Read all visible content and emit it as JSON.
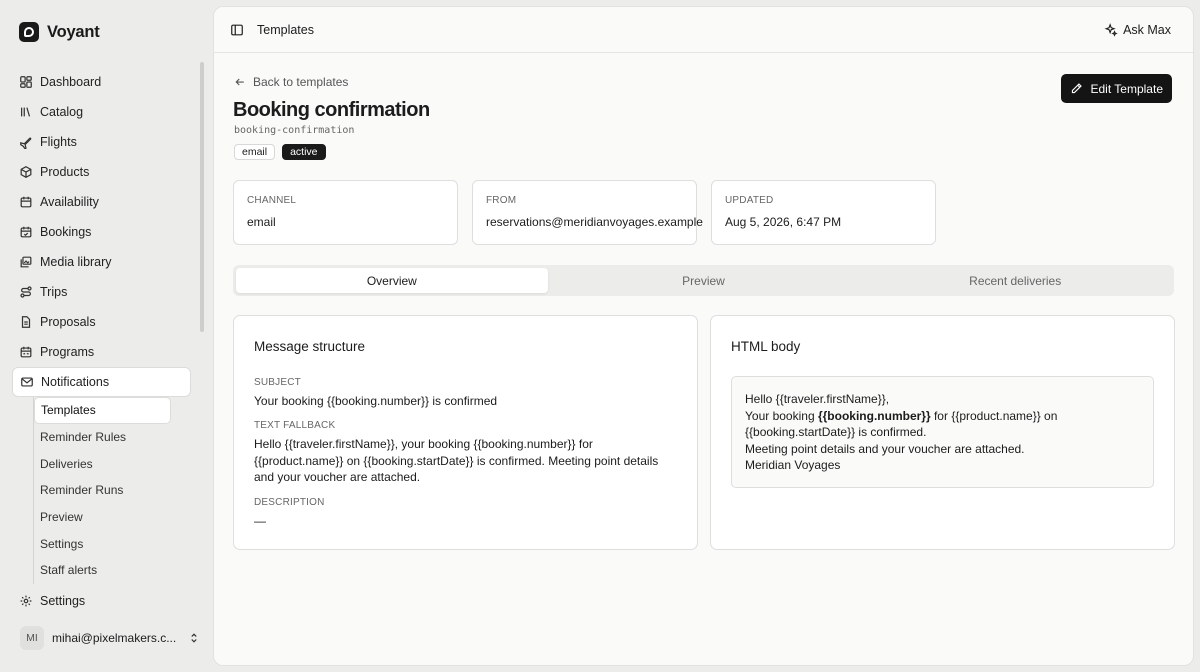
{
  "brand": {
    "name": "Voyant"
  },
  "nav": {
    "items": [
      {
        "label": "Dashboard"
      },
      {
        "label": "Catalog"
      },
      {
        "label": "Flights"
      },
      {
        "label": "Products"
      },
      {
        "label": "Availability"
      },
      {
        "label": "Bookings"
      },
      {
        "label": "Media library"
      },
      {
        "label": "Trips"
      },
      {
        "label": "Proposals"
      },
      {
        "label": "Programs"
      },
      {
        "label": "Notifications"
      }
    ],
    "sub_items": [
      {
        "label": "Templates"
      },
      {
        "label": "Reminder Rules"
      },
      {
        "label": "Deliveries"
      },
      {
        "label": "Reminder Runs"
      },
      {
        "label": "Preview"
      },
      {
        "label": "Settings"
      },
      {
        "label": "Staff alerts"
      }
    ],
    "settings": "Settings"
  },
  "user": {
    "initials": "MI",
    "email": "mihai@pixelmakers.c..."
  },
  "topbar": {
    "title": "Templates",
    "ask": "Ask Max"
  },
  "page": {
    "back": "Back to templates",
    "title": "Booking confirmation",
    "slug": "booking-confirmation",
    "tags": [
      "email",
      "active"
    ],
    "edit": "Edit Template"
  },
  "info": [
    {
      "label": "CHANNEL",
      "value": "email"
    },
    {
      "label": "FROM",
      "value": "reservations@meridianvoyages.example"
    },
    {
      "label": "UPDATED",
      "value": "Aug 5, 2026, 6:47 PM"
    }
  ],
  "tabs": [
    "Overview",
    "Preview",
    "Recent deliveries"
  ],
  "structure": {
    "title": "Message structure",
    "subject_label": "SUBJECT",
    "subject": "Your booking {{booking.number}} is confirmed",
    "fallback_label": "TEXT FALLBACK",
    "fallback": "Hello {{traveler.firstName}}, your booking {{booking.number}} for {{product.name}} on {{booking.startDate}} is confirmed. Meeting point details and your voucher are attached.",
    "description_label": "DESCRIPTION",
    "description": "—"
  },
  "html_body": {
    "title": "HTML body",
    "line1": "Hello {{traveler.firstName}},",
    "line2_pre": "Your booking ",
    "line2_bold": "{{booking.number}}",
    "line2_post": " for {{product.name}} on {{booking.startDate}} is confirmed.",
    "line3": "Meeting point details and your voucher are attached.",
    "line4": "Meridian Voyages"
  }
}
